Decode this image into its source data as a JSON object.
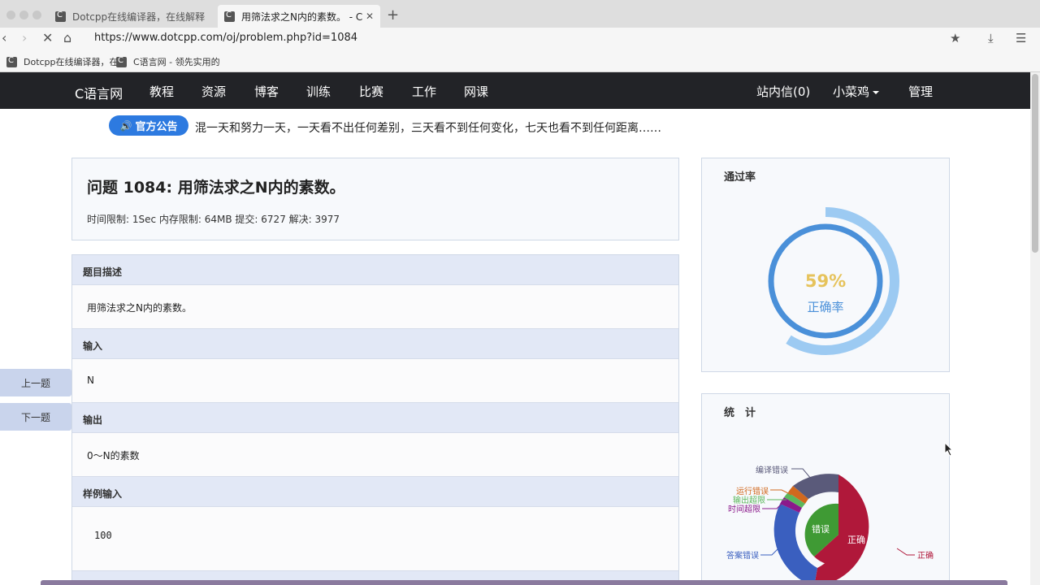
{
  "browser": {
    "tabs": [
      {
        "title": "Dotcpp在线编译器，在线解释器",
        "active": false
      },
      {
        "title": "用筛法求之N内的素数。 - C语言网",
        "active": true
      }
    ],
    "url": "https://www.dotcpp.com/oj/problem.php?id=1084",
    "bookmarks": [
      "Dotcpp在线编译器，在",
      "C语言网 - 领先实用的"
    ]
  },
  "site_nav": {
    "brand": "C语言网",
    "items": [
      "教程",
      "资源",
      "博客",
      "训练",
      "比赛",
      "工作",
      "网课"
    ],
    "right": {
      "messages": "站内信(0)",
      "user": "小菜鸡",
      "admin": "管理"
    }
  },
  "notice": {
    "badge": "官方公告",
    "text": "混一天和努力一天，一天看不出任何差别，三天看不到任何变化，七天也看不到任何距离……"
  },
  "side_buttons": {
    "prev": "上一题",
    "next": "下一题"
  },
  "problem": {
    "title": "问题 1084: 用筛法求之N内的素数。",
    "meta": "时间限制: 1Sec 内存限制: 64MB 提交: 6727 解决: 3977",
    "sections": [
      {
        "head": "题目描述",
        "body": "用筛法求之N内的素数。"
      },
      {
        "head": "输入",
        "body": "N"
      },
      {
        "head": "输出",
        "body": "0～N的素数"
      },
      {
        "head": "样例输入",
        "body": "100"
      }
    ]
  },
  "pass_rate": {
    "title": "通过率",
    "percent_label": "59%",
    "caption": "正确率",
    "value": 59,
    "colors": {
      "ring": "#4a90d9",
      "outer": "#9ccaf2",
      "percent": "#e6c35c"
    }
  },
  "stats": {
    "title": "统　计",
    "inner_labels": {
      "wrong": "错误",
      "correct": "正确"
    },
    "labels": [
      {
        "text": "编译错误",
        "color": "#5a5a7a"
      },
      {
        "text": "运行错误",
        "color": "#d2691e"
      },
      {
        "text": "输出超限",
        "color": "#5cb85c"
      },
      {
        "text": "时间超限",
        "color": "#8b1a8b"
      },
      {
        "text": "答案错误",
        "color": "#3a5fbf"
      },
      {
        "text": "正确",
        "color": "#b0183a"
      }
    ]
  }
}
